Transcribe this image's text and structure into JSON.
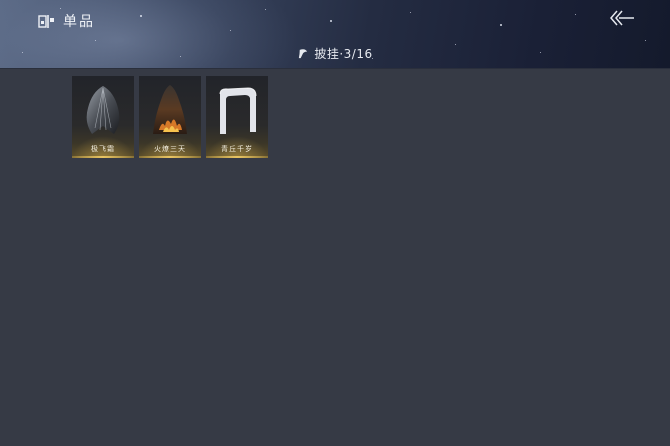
{
  "header": {
    "title": "单品",
    "title_icon": "wardrobe-icon",
    "back_icon": "back-arrow-icon"
  },
  "category": {
    "icon": "cape-icon",
    "label": "披挂·3/16"
  },
  "items": [
    {
      "name": "极飞霜",
      "art": "dark-feather-cape"
    },
    {
      "name": "火燎三天",
      "art": "flame-cape"
    },
    {
      "name": "青丘千岁",
      "art": "white-scarf"
    }
  ],
  "colors": {
    "background": "#363a45",
    "accent_gold": "#e7c463",
    "text": "#eef1f6"
  }
}
